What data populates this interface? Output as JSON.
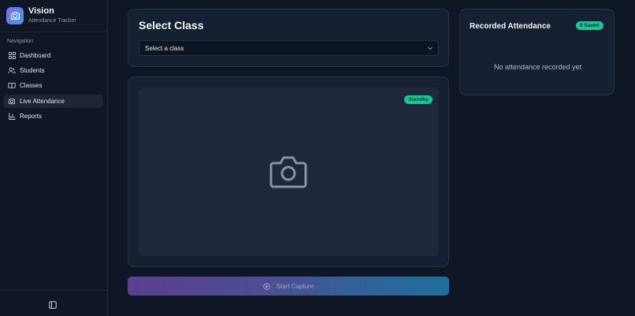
{
  "brand": {
    "title": "Vision",
    "subtitle": "Attendance Tracker",
    "logo_icon": "camera-icon"
  },
  "sidebar": {
    "heading": "Navigation",
    "items": [
      {
        "label": "Dashboard",
        "icon": "grid-icon",
        "active": false
      },
      {
        "label": "Students",
        "icon": "users-icon",
        "active": false
      },
      {
        "label": "Classes",
        "icon": "book-icon",
        "active": false
      },
      {
        "label": "Live Attendance",
        "icon": "camera-icon",
        "active": true
      },
      {
        "label": "Reports",
        "icon": "bar-chart-icon",
        "active": false
      }
    ],
    "toggle_icon": "sidebar-toggle-icon"
  },
  "select_class": {
    "title": "Select Class",
    "placeholder": "Select a class"
  },
  "camera": {
    "status": "Standby"
  },
  "capture": {
    "label": "Start Capture"
  },
  "recorded": {
    "title": "Recorded Attendance",
    "badge": "0 Saved",
    "empty_text": "No attendance recorded yet"
  },
  "colors": {
    "accent_green": "#19c59a",
    "background": "#0f1626",
    "panel": "#162033"
  }
}
